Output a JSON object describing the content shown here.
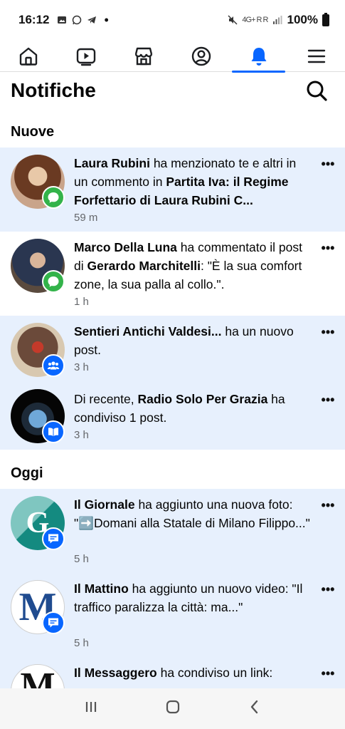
{
  "status_bar": {
    "time": "16:12",
    "battery": "100%",
    "signal_text": "4G+ R R"
  },
  "nav": {
    "items": [
      {
        "name": "home-icon"
      },
      {
        "name": "video-icon"
      },
      {
        "name": "marketplace-icon"
      },
      {
        "name": "profile-icon"
      },
      {
        "name": "bell-icon",
        "active": true
      },
      {
        "name": "menu-icon"
      }
    ],
    "accent_color": "#0866ff"
  },
  "header": {
    "title": "Notifiche"
  },
  "sections": {
    "new": "Nuove",
    "today": "Oggi"
  },
  "notifications": [
    {
      "p1_bold": "Laura Rubini",
      "p1": " ha menzionato te e altri in un commento in ",
      "p2_bold": "Partita Iva: il Regime Forfettario di Laura Rubini C...",
      "p2": "",
      "time": "59 m",
      "badge": "comment-icon",
      "unread": true
    },
    {
      "p1_bold": "Marco Della Luna",
      "p1": " ha commentato il post di ",
      "p2_bold": "Gerardo Marchitelli",
      "p2": ": \"È la sua comfort zone, la sua palla al collo.\".",
      "time": "1 h",
      "badge": "comment-icon",
      "unread": false
    },
    {
      "p1_bold": "Sentieri Antichi Valdesi...",
      "p1": " ha un nuovo post.",
      "p2_bold": "",
      "p2": "",
      "time": "3 h",
      "badge": "group-icon",
      "unread": true
    },
    {
      "p0": "Di recente, ",
      "p1_bold": "Radio Solo Per Grazia",
      "p1": " ha condiviso 1 post.",
      "p2_bold": "",
      "p2": "",
      "time": "3 h",
      "badge": "page-icon",
      "unread": true
    },
    {
      "p1_bold": "Il Giornale",
      "p1": " ha aggiunto una nuova foto: \"➡️Domani alla Statale di Milano Filippo...\"",
      "p2_bold": "",
      "p2": "",
      "time": "5 h",
      "badge": "news-icon",
      "unread": true
    },
    {
      "p1_bold": "Il Mattino",
      "p1": " ha aggiunto un nuovo video: \"Il traffico paralizza la città: ma...\"",
      "p2_bold": "",
      "p2": "",
      "time": "5 h",
      "badge": "news-icon",
      "unread": true
    },
    {
      "p1_bold": "Il Messaggero",
      "p1": " ha condiviso un link:",
      "p2_bold": "",
      "p2": "",
      "time": "",
      "badge": "news-icon",
      "unread": true
    }
  ],
  "more_label": "•••",
  "avatar_letters": {
    "giornale": "G",
    "mattino": "M",
    "messaggero": "M"
  }
}
